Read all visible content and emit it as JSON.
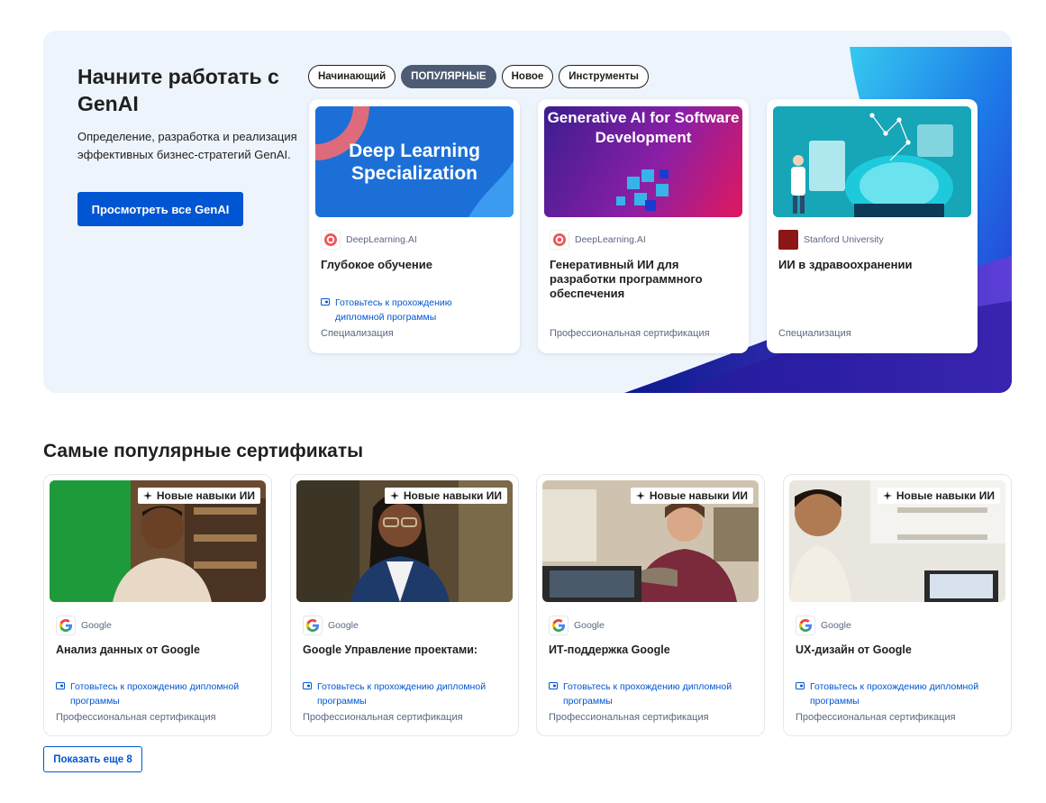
{
  "genai": {
    "title": "Начните работать с GenAI",
    "description": "Определение, разработка и реализация эффективных бизнес-стратегий GenAI.",
    "cta_label": "Просмотреть все GenAI",
    "chips": [
      "Начинающий",
      "ПОПУЛЯРНЫЕ",
      "Новое",
      "Инструменты"
    ],
    "active_chip": "ПОПУЛЯРНЫЕ",
    "cards": [
      {
        "image_text": "Deep Learning Specialization",
        "partner": "DeepLearning.AI",
        "title": "Глубокое обучение",
        "degree_label": "Готовьтесь к прохождению дипломной программы",
        "credential": "Специализация"
      },
      {
        "image_text": "Generative AI for Software Development",
        "partner": "DeepLearning.AI",
        "title": "Генеративный ИИ для разработки программного обеспечения",
        "credential": "Профессиональная сертификация"
      },
      {
        "partner": "Stanford University",
        "title": "ИИ в здравоохранении",
        "credential": "Специализация"
      }
    ]
  },
  "popular": {
    "title": "Самые популярные сертификаты",
    "badge": "Новые навыки ИИ",
    "cards": [
      {
        "partner": "Google",
        "title": "Анализ данных от Google",
        "degree_label": "Готовьтесь к прохождению дипломной программы",
        "credential": "Профессиональная сертификация"
      },
      {
        "partner": "Google",
        "title": "Google Управление проектами:",
        "degree_label": "Готовьтесь к прохождению дипломной программы",
        "credential": "Профессиональная сертификация"
      },
      {
        "partner": "Google",
        "title": "ИТ-поддержка Google",
        "degree_label": "Готовьтесь к прохождению дипломной программы",
        "credential": "Профессиональная сертификация"
      },
      {
        "partner": "Google",
        "title": "UX-дизайн от Google",
        "degree_label": "Готовьтесь к прохождению дипломной программы",
        "credential": "Профессиональная сертификация"
      }
    ],
    "show_more_label": "Показать еще 8"
  },
  "icons": {
    "partner_logos": [
      "deeplearning-ai-logo",
      "stanford-logo",
      "google-logo"
    ],
    "degree": "degree-icon",
    "badge": "sparkle-icon"
  },
  "colors": {
    "brand_blue": "#0056d2",
    "banner_bg": "#eef4fc",
    "active_chip": "#4d5b73"
  }
}
